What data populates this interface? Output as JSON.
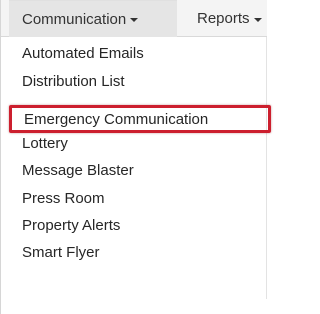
{
  "navbar": {
    "tabs": [
      {
        "label": "Communication",
        "active": true,
        "has_caret": true
      },
      {
        "label": "Reports",
        "active": false,
        "has_caret": true
      }
    ]
  },
  "dropdown": {
    "items": [
      {
        "label": "Automated Emails",
        "highlighted": false
      },
      {
        "label": "Distribution List",
        "highlighted": false
      },
      {
        "label": "Emergency Communication",
        "highlighted": true
      },
      {
        "label": "Lottery",
        "highlighted": false
      },
      {
        "label": "Message Blaster",
        "highlighted": false
      },
      {
        "label": "Press Room",
        "highlighted": false
      },
      {
        "label": "Property Alerts",
        "highlighted": false
      },
      {
        "label": "Smart Flyer",
        "highlighted": false
      }
    ]
  },
  "colors": {
    "highlight_border": "#cc1f2e",
    "navbar_bg": "#f4f4f4",
    "active_tab_bg": "#e5e5e5",
    "text": "#333333"
  }
}
